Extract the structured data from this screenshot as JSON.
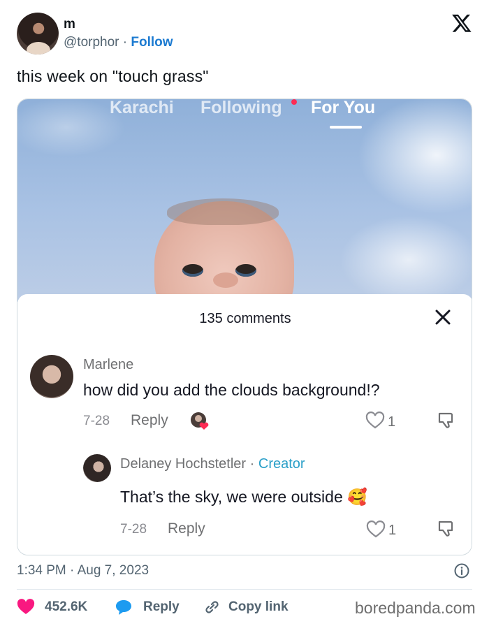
{
  "tweet": {
    "author_name": "m",
    "handle": "@torphor",
    "separator": "·",
    "follow_label": "Follow",
    "text": "this week on \"touch grass\"",
    "timestamp": "1:34 PM · Aug 7, 2023",
    "likes": "452.6K",
    "reply_label": "Reply",
    "copy_link_label": "Copy link"
  },
  "media": {
    "tabs": [
      "Karachi",
      "Following",
      "For You"
    ],
    "comments_title": "135 comments",
    "comments": [
      {
        "author": "Marlene",
        "text": "how did you add the clouds background!?",
        "date": "7-28",
        "reply_label": "Reply",
        "likes": "1"
      },
      {
        "author": "Delaney Hochstetler",
        "separator": "·",
        "badge": "Creator",
        "text": "That’s the sky, we were outside 🥰",
        "date": "7-28",
        "reply_label": "Reply",
        "likes": "1"
      }
    ]
  },
  "watermark": "boredpanda.com",
  "colors": {
    "follow_blue": "#1d7bd1",
    "like_pink": "#f91880",
    "reply_blue": "#1d9bf0",
    "creator_teal": "#2a9fc8",
    "tiktok_red": "#fe2c55"
  },
  "icons": [
    "x-logo-icon",
    "search-icon",
    "close-icon",
    "heart-icon",
    "dislike-icon",
    "info-icon",
    "reply-bubble-icon",
    "link-icon"
  ]
}
